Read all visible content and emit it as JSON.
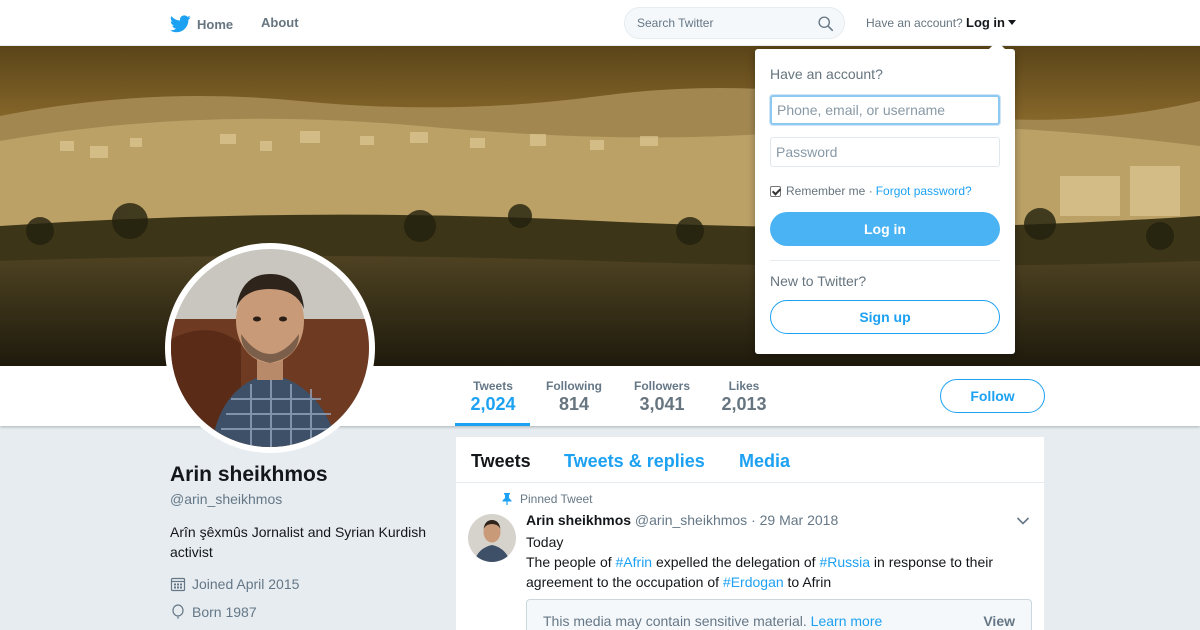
{
  "nav": {
    "home_label": "Home",
    "about_label": "About",
    "search_placeholder": "Search Twitter",
    "have_account": "Have an account?",
    "login_label": "Log in"
  },
  "profile": {
    "name": "Arin sheikhmos",
    "handle": "@arin_sheikhmos",
    "bio": "Arîn şêxmûs Jornalist and Syrian Kurdish activist",
    "joined": "Joined April 2015",
    "born": "Born 1987"
  },
  "stats": [
    {
      "label": "Tweets",
      "value": "2,024",
      "active": true
    },
    {
      "label": "Following",
      "value": "814"
    },
    {
      "label": "Followers",
      "value": "3,041"
    },
    {
      "label": "Likes",
      "value": "2,013"
    }
  ],
  "follow_label": "Follow",
  "timeline": {
    "tabs": [
      "Tweets",
      "Tweets & replies",
      "Media"
    ],
    "tweet": {
      "pinned_label": "Pinned Tweet",
      "name": "Arin sheikhmos",
      "handle": "@arin_sheikhmos",
      "date": "· 29 Mar 2018",
      "line1": "Today",
      "text_parts": [
        "The people of ",
        "#Afrin",
        " expelled the delegation of ",
        "#Russia",
        " in response to their agreement to the occupation of ",
        "#Erdogan",
        " to Afrin"
      ],
      "media_warning": "This media may contain sensitive material.",
      "learn_more": "Learn more",
      "view_label": "View"
    }
  },
  "login_dropdown": {
    "title": "Have an account?",
    "username_placeholder": "Phone, email, or username",
    "password_placeholder": "Password",
    "remember_me": "Remember me ·",
    "forgot_password": "Forgot password?",
    "login_button": "Log in",
    "new_to_twitter": "New to Twitter?",
    "signup_button": "Sign up"
  },
  "colors": {
    "accent": "#1da1f2",
    "background": "#e6ecf0"
  }
}
